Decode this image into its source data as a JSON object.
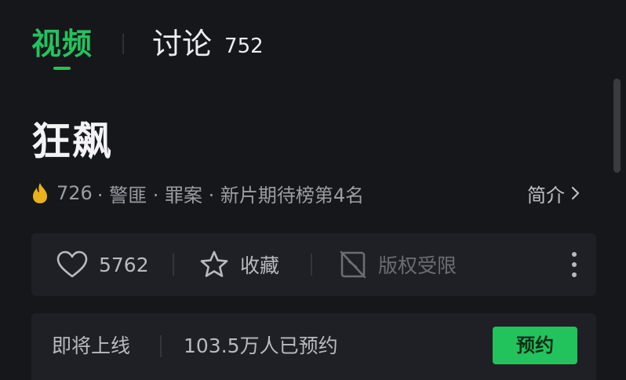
{
  "tabs": {
    "video_label": "视频",
    "discuss_label": "讨论",
    "discuss_count": "752"
  },
  "show": {
    "title": "狂飙",
    "heat": "726",
    "tags_text": "· 警匪 · 罪案 · 新片期待榜第4名",
    "intro_label": "简介"
  },
  "actions": {
    "like_count": "5762",
    "favorite_label": "收藏",
    "copyright_label": "版权受限"
  },
  "upcoming": {
    "status_label": "即将上线",
    "reservation_text": "103.5万人已预约",
    "reserve_button": "预约"
  },
  "colors": {
    "accent": "#22c35d",
    "background": "#16171b",
    "card": "#1f2025",
    "flame": "#e9b21c"
  },
  "icons": {
    "heat": "flame-icon",
    "intro": "chevron-right-icon",
    "like": "heart-icon",
    "favorite": "star-icon",
    "copyright": "no-copyright-icon",
    "more": "more-vertical-icon"
  }
}
